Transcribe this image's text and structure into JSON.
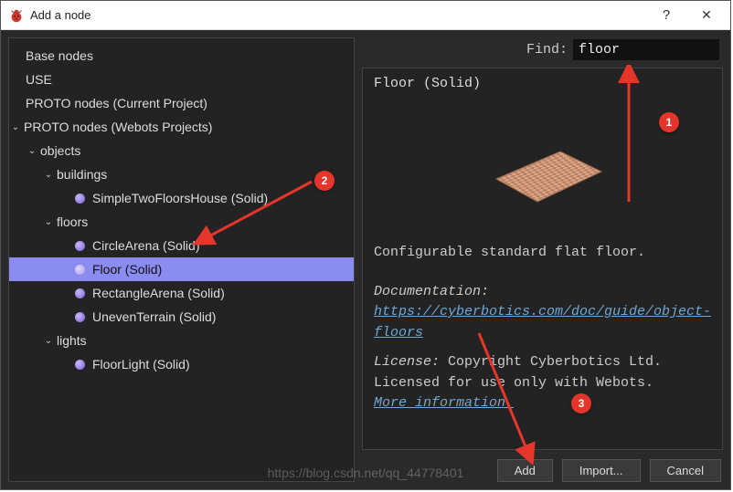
{
  "window": {
    "title": "Add a node"
  },
  "tree": {
    "base_nodes": "Base nodes",
    "use": "USE",
    "proto_current": "PROTO nodes (Current Project)",
    "proto_webots": "PROTO nodes (Webots Projects)",
    "objects": "objects",
    "buildings": "buildings",
    "simple_house": "SimpleTwoFloorsHouse (Solid)",
    "floors": "floors",
    "circle_arena": "CircleArena (Solid)",
    "floor": "Floor (Solid)",
    "rectangle_arena": "RectangleArena (Solid)",
    "uneven_terrain": "UnevenTerrain (Solid)",
    "lights": "lights",
    "floor_light": "FloorLight (Solid)"
  },
  "find": {
    "label": "Find:",
    "value": "floor"
  },
  "detail": {
    "title": "Floor (Solid)",
    "description": "Configurable standard flat floor.",
    "doc_label": "Documentation: ",
    "doc_url": "https://cyberbotics.com/doc/guide/object-floors",
    "license_label": "License: ",
    "license_text": "Copyright Cyberbotics Ltd. Licensed for use only with Webots.",
    "more_info": "More information."
  },
  "buttons": {
    "add": "Add",
    "import": "Import...",
    "cancel": "Cancel"
  },
  "annotations": {
    "b1": "1",
    "b2": "2",
    "b3": "3"
  },
  "watermark": "https://blog.csdn.net/qq_44778401"
}
